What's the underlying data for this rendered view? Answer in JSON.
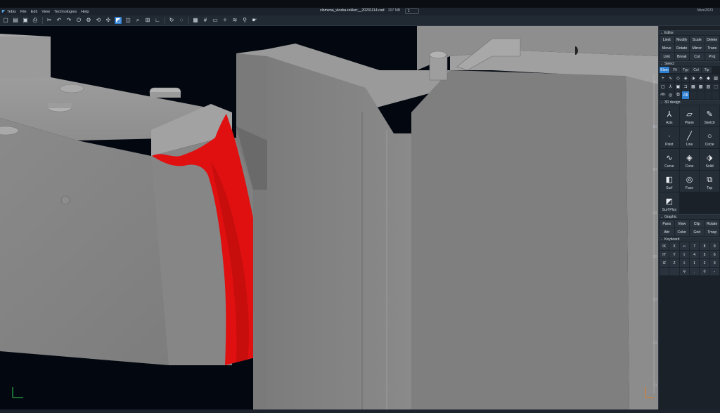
{
  "app": {
    "name": "Tebis",
    "menu": [
      "File",
      "Edit",
      "View",
      "Technologies",
      "Help"
    ],
    "file_title": "zlomena_vlozka-reklerr__20231114.cad",
    "file_size": "207 MB",
    "page_selector": "1",
    "user_label": "Mvor2023"
  },
  "toolbar": {
    "icons": [
      "new-file-icon",
      "open-icon",
      "save-icon",
      "print-icon",
      "cut-icon",
      "undo-icon",
      "redo-icon",
      "power-icon",
      "settings-icon",
      "measure-icon",
      "snap-icon",
      "view-cube-icon",
      "layers-icon",
      "zoom-icon",
      "zoom-fit-icon",
      "axis-icon",
      "rotate-icon",
      "render-icon",
      "grid-icon",
      "frame-icon",
      "section-icon",
      "light-icon",
      "probe-icon",
      "pointer-icon"
    ]
  },
  "viewport": {
    "ruler_labels": [
      "70",
      "60",
      "50",
      "40",
      "30",
      "20",
      "10",
      "0"
    ],
    "highlight_color": "#e01010",
    "background_color": "#030810"
  },
  "panel": {
    "editor": {
      "title": "Editor",
      "buttons": [
        "Limit",
        "Modify",
        "Scale",
        "Delete",
        "Move",
        "Rotate",
        "Mirror",
        "Trans",
        "Link",
        "Break",
        "Cut",
        "Proj"
      ]
    },
    "select": {
      "title": "Select",
      "tabs": [
        "Elem",
        "Fil",
        "Typ",
        "Col",
        "Tip"
      ],
      "active_tab": "Elem",
      "all_label": "All"
    },
    "design3d": {
      "title": "3D design",
      "items": [
        {
          "label": "Axis",
          "glyph": "⅄"
        },
        {
          "label": "Plane",
          "glyph": "▱"
        },
        {
          "label": "Sketch",
          "glyph": "✎"
        },
        {
          "label": "Point",
          "glyph": "·"
        },
        {
          "label": "Line",
          "glyph": "╱"
        },
        {
          "label": "Circle",
          "glyph": "○"
        },
        {
          "label": "Curve",
          "glyph": "∿"
        },
        {
          "label": "Cons",
          "glyph": "◈"
        },
        {
          "label": "Solid",
          "glyph": "⬗"
        },
        {
          "label": "Surf",
          "glyph": "◧"
        },
        {
          "label": "Face",
          "glyph": "◎"
        },
        {
          "label": "Top",
          "glyph": "⧉"
        },
        {
          "label": "Surf Plus",
          "glyph": "◩"
        }
      ]
    },
    "graphic": {
      "title": "Graphic",
      "buttons": [
        "Pans",
        "View",
        "Clip",
        "Rotate",
        "Attr",
        "Color",
        "Grid",
        "Trnsp"
      ]
    },
    "keyboard": {
      "title": "Keyboard",
      "keys": [
        "IX",
        "X",
        "⇦",
        "7",
        "8",
        "9",
        "IY",
        "Y",
        "⇧",
        "4",
        "5",
        "6",
        "IZ",
        "Z",
        "⇩",
        "1",
        "2",
        "3",
        "",
        "",
        "⚲",
        ".",
        "0",
        "-"
      ]
    }
  }
}
